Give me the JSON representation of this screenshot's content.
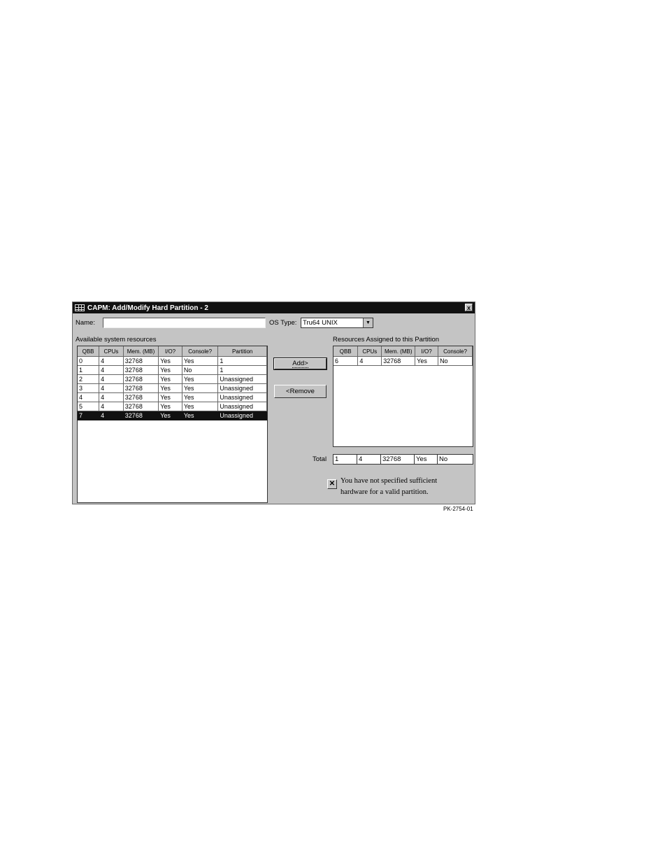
{
  "window": {
    "title": "CAPM: Add/Modify Hard Partition - 2",
    "close_label": "x"
  },
  "form": {
    "name_label": "Name:",
    "name_value": "",
    "os_type_label": "OS Type:",
    "os_type_value": "Tru64 UNIX"
  },
  "available": {
    "label": "Available system resources",
    "columns": [
      "QBB",
      "CPUs",
      "Mem. (MB)",
      "I/O?",
      "Console?",
      "Partition"
    ],
    "rows": [
      [
        "0",
        "4",
        "32768",
        "Yes",
        "Yes",
        "1"
      ],
      [
        "1",
        "4",
        "32768",
        "Yes",
        "No",
        "1"
      ],
      [
        "2",
        "4",
        "32768",
        "Yes",
        "Yes",
        "Unassigned"
      ],
      [
        "3",
        "4",
        "32768",
        "Yes",
        "Yes",
        "Unassigned"
      ],
      [
        "4",
        "4",
        "32768",
        "Yes",
        "Yes",
        "Unassigned"
      ],
      [
        "5",
        "4",
        "32768",
        "Yes",
        "Yes",
        "Unassigned"
      ],
      [
        "7",
        "4",
        "32768",
        "Yes",
        "Yes",
        "Unassigned"
      ]
    ],
    "selected_row": 6
  },
  "buttons": {
    "add_label": "Add>",
    "remove_label": "<Remove"
  },
  "assigned": {
    "label": "Resources Assigned to this Partition",
    "columns": [
      "QBB",
      "CPUs",
      "Mem. (MB)",
      "I/O?",
      "Console?"
    ],
    "rows": [
      [
        "6",
        "4",
        "32768",
        "Yes",
        "No"
      ]
    ]
  },
  "total": {
    "label": "Total",
    "values": [
      "1",
      "4",
      "32768",
      "Yes",
      "No"
    ]
  },
  "warning": {
    "icon": "error-x-icon",
    "line1": "You have not specified sufficient",
    "line2": "hardware for a valid partition."
  },
  "figure_id": "PK-2754-01"
}
